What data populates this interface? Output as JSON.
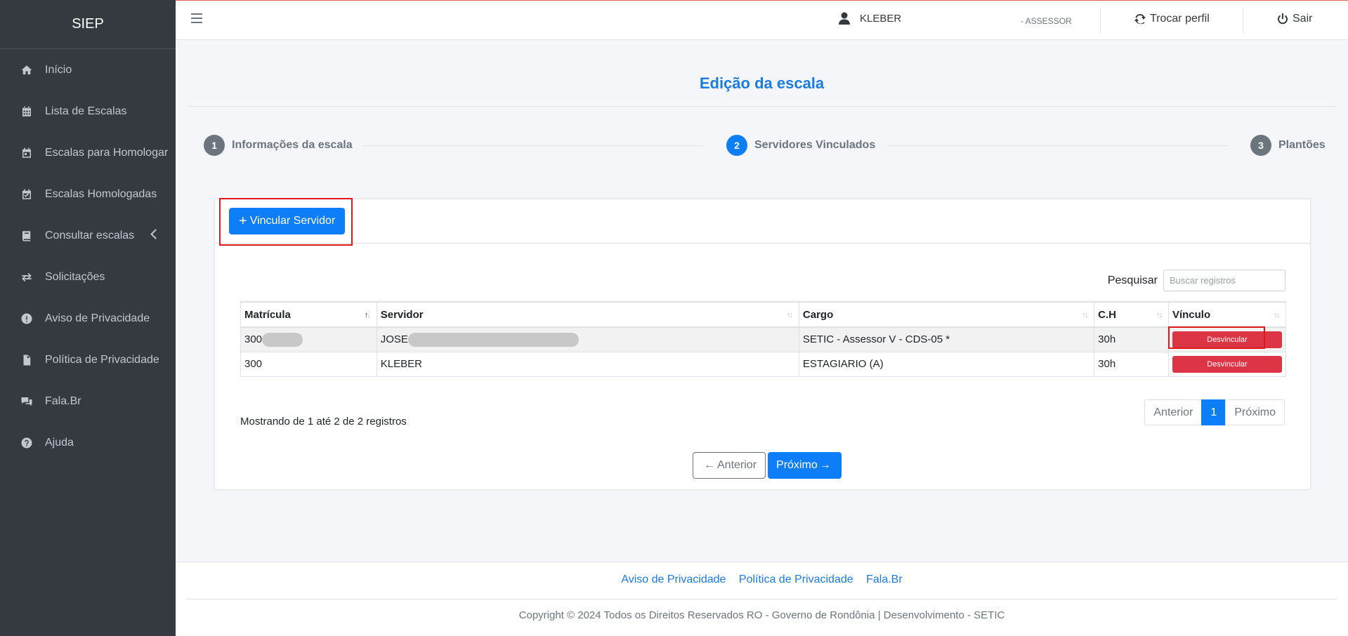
{
  "sidebar": {
    "brand": "SIEP",
    "items": [
      {
        "label": "Início",
        "icon": "home-icon"
      },
      {
        "label": "Lista de Escalas",
        "icon": "calendar-grid-icon"
      },
      {
        "label": "Escalas para Homologar",
        "icon": "calendar-icon"
      },
      {
        "label": "Escalas Homologadas",
        "icon": "calendar-check-icon"
      },
      {
        "label": "Consultar escalas",
        "icon": "book-icon"
      },
      {
        "label": "Solicitações",
        "icon": "exchange-icon"
      },
      {
        "label": "Aviso de Privacidade",
        "icon": "exclamation-icon"
      },
      {
        "label": "Política de Privacidade",
        "icon": "file-icon"
      },
      {
        "label": "Fala.Br",
        "icon": "comments-icon"
      },
      {
        "label": "Ajuda",
        "icon": "question-icon"
      }
    ]
  },
  "topbar": {
    "user_name": "KLEBER",
    "role": "- ASSESSOR",
    "switch_profile": "Trocar perfil",
    "logout": "Sair"
  },
  "page": {
    "title": "Edição da escala"
  },
  "stepper": {
    "steps": [
      {
        "number": "1",
        "label": "Informações da escala",
        "active": false
      },
      {
        "number": "2",
        "label": "Servidores Vinculados",
        "active": true
      },
      {
        "number": "3",
        "label": "Plantões",
        "active": false
      }
    ]
  },
  "card": {
    "add_button": "Vincular Servidor",
    "search_label": "Pesquisar",
    "search_placeholder": "Buscar registros",
    "columns": [
      "Matrícula",
      "Servidor",
      "Cargo",
      "C.H",
      "Vínculo"
    ],
    "rows": [
      {
        "matricula": "300",
        "servidor": "JOSE",
        "cargo": "SETIC - Assessor V - CDS-05 *",
        "ch": "30h",
        "action": "Desvincular",
        "redacted": true
      },
      {
        "matricula": "300",
        "servidor": "KLEBER",
        "cargo": "ESTAGIARIO (A)",
        "ch": "30h",
        "action": "Desvincular",
        "redacted": false
      }
    ],
    "info": "Mostrando de 1 até 2 de 2 registros",
    "pager": {
      "prev": "Anterior",
      "current": "1",
      "next": "Próximo"
    },
    "prev_button": "Anterior",
    "next_button": "Próximo"
  },
  "footer": {
    "links": [
      "Aviso de Privacidade",
      "Política de Privacidade",
      "Fala.Br"
    ],
    "copyright": "Copyright © 2024 Todos os Direitos Reservados RO - Governo de Rondônia | Desenvolvimento - SETIC"
  },
  "colors": {
    "sidebar_bg": "#343a40",
    "primary": "#0d7ef8",
    "danger": "#dc3545",
    "title": "#1a7be0",
    "highlight_outline": "#e01818"
  }
}
